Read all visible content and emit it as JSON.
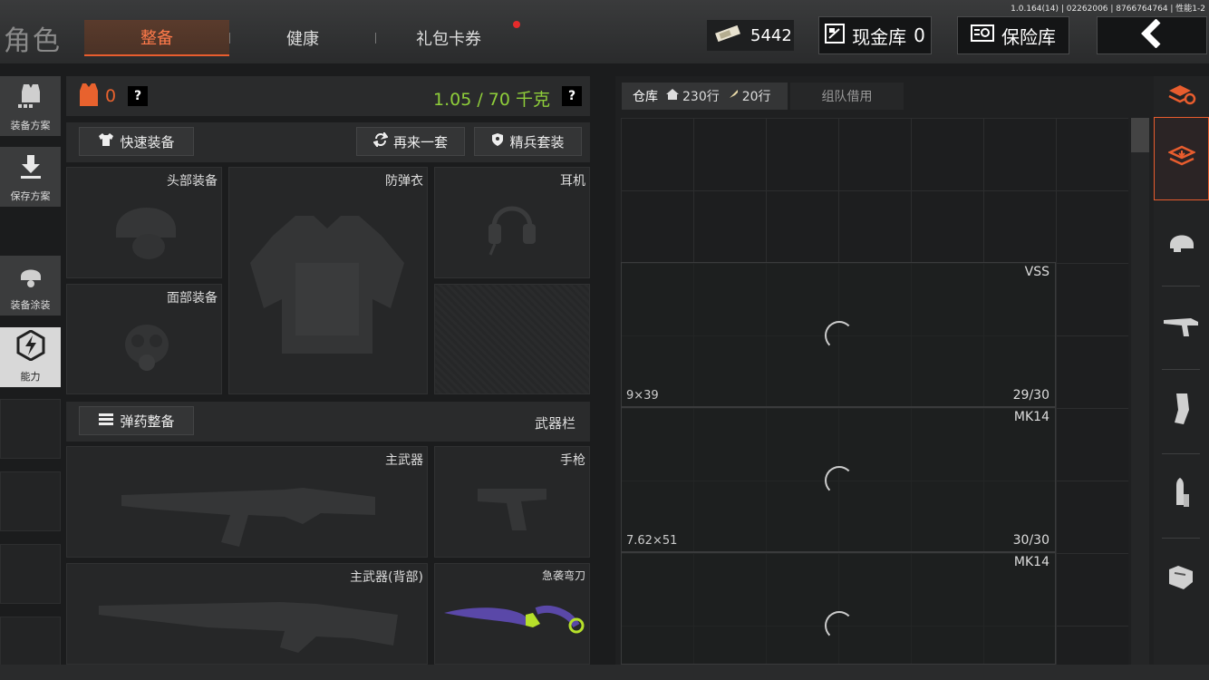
{
  "version": "1.0.164(14) | 02262006 | 8766764764 | 性能1-2",
  "header": {
    "title": "角色",
    "tabs": [
      {
        "label": "整备",
        "active": true
      },
      {
        "label": "健康",
        "active": false
      },
      {
        "label": "礼包卡券",
        "active": false,
        "notification": true
      }
    ],
    "currency_value": "5442",
    "cash_vault": "现金库",
    "cash_vault_count": "0",
    "safe": "保险库"
  },
  "left_rail": [
    {
      "label": "装备方案",
      "icon": "vest-grid-icon"
    },
    {
      "label": "保存方案",
      "icon": "download-icon"
    },
    {
      "label": "装备涂装",
      "icon": "helmet-paint-icon"
    },
    {
      "label": "能力",
      "icon": "ability-bolt-icon",
      "active": true
    }
  ],
  "equipment": {
    "armor_count": "0",
    "weight": "1.05 / 70 千克",
    "quick_equip": "快速装备",
    "another_set": "再来一套",
    "elite_set": "精兵套装",
    "slots": {
      "head": "头部装备",
      "vest": "防弹衣",
      "headset": "耳机",
      "face": "面部装备"
    },
    "ammo_setup": "弹药整备",
    "weapon_bar": "武器栏",
    "weapons": {
      "primary": "主武器",
      "pistol": "手枪",
      "primary_back": "主武器(背部)",
      "melee": "急袭弯刀"
    }
  },
  "warehouse": {
    "tab_label": "仓库",
    "rows": "230行",
    "rows2": "20行",
    "team_borrow": "组队借用",
    "items": [
      {
        "name": "VSS",
        "caliber": "9×39",
        "ammo": "29/30"
      },
      {
        "name": "MK14",
        "caliber": "7.62×51",
        "ammo": "30/30"
      },
      {
        "name": "MK14",
        "caliber": "",
        "ammo": ""
      }
    ]
  },
  "right_rail": [
    "layers-refresh-icon",
    "storage-stack-icon",
    "helmet-icon",
    "rifle-icon",
    "magazine-icon",
    "bullets-icon",
    "armor-plate-icon"
  ],
  "colors": {
    "accent": "#e85d2e",
    "weight_green": "#8fce3a"
  }
}
